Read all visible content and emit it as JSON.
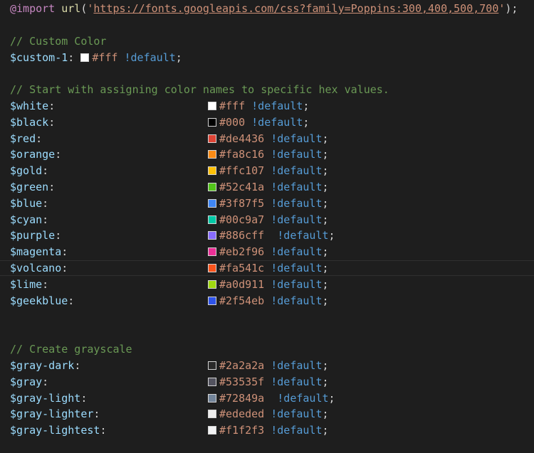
{
  "import_line": {
    "keyword": "@import",
    "func": "url",
    "open": "(",
    "quote_open": "'",
    "url": "https://fonts.googleapis.com/css?family=Poppins:300,400,500,700",
    "quote_close": "'",
    "close": ");"
  },
  "custom": {
    "comment": "// Custom Color",
    "name": "$custom-1",
    "colon": ":",
    "value": "#fff",
    "swatch": "#ffffff",
    "flag": "!default",
    "semi": ";"
  },
  "colors_comment": "// Start with assigning color names to specific hex values.",
  "colors": [
    {
      "name": "$white",
      "colon": ":",
      "value": "#fff",
      "swatch": "#ffffff",
      "gap": " ",
      "flag": "!default",
      "semi": ";"
    },
    {
      "name": "$black",
      "colon": ":",
      "value": "#000",
      "swatch": "#000000",
      "gap": " ",
      "flag": "!default",
      "semi": ";"
    },
    {
      "name": "$red",
      "colon": ":",
      "value": "#de4436",
      "swatch": "#de4436",
      "gap": " ",
      "flag": "!default",
      "semi": ";"
    },
    {
      "name": "$orange",
      "colon": ":",
      "value": "#fa8c16",
      "swatch": "#fa8c16",
      "gap": " ",
      "flag": "!default",
      "semi": ";"
    },
    {
      "name": "$gold",
      "colon": ":",
      "value": "#ffc107",
      "swatch": "#ffc107",
      "gap": " ",
      "flag": "!default",
      "semi": ";"
    },
    {
      "name": "$green",
      "colon": ":",
      "value": "#52c41a",
      "swatch": "#52c41a",
      "gap": " ",
      "flag": "!default",
      "semi": ";"
    },
    {
      "name": "$blue",
      "colon": ":",
      "value": "#3f87f5",
      "swatch": "#3f87f5",
      "gap": " ",
      "flag": "!default",
      "semi": ";"
    },
    {
      "name": "$cyan",
      "colon": ":",
      "value": "#00c9a7",
      "swatch": "#00c9a7",
      "gap": " ",
      "flag": "!default",
      "semi": ";"
    },
    {
      "name": "$purple",
      "colon": ":",
      "value": "#886cff",
      "swatch": "#886cff",
      "gap": "  ",
      "flag": "!default",
      "semi": ";"
    },
    {
      "name": "$magenta",
      "colon": ":",
      "value": "#eb2f96",
      "swatch": "#eb2f96",
      "gap": " ",
      "flag": "!default",
      "semi": ";"
    },
    {
      "name": "$volcano",
      "colon": ":",
      "value": "#fa541c",
      "swatch": "#fa541c",
      "gap": " ",
      "flag": "!default",
      "semi": ";"
    },
    {
      "name": "$lime",
      "colon": ":",
      "value": "#a0d911",
      "swatch": "#a0d911",
      "gap": " ",
      "flag": "!default",
      "semi": ";"
    },
    {
      "name": "$geekblue",
      "colon": ":",
      "value": "#2f54eb",
      "swatch": "#2f54eb",
      "gap": " ",
      "flag": "!default",
      "semi": ";"
    }
  ],
  "gray_comment": "// Create grayscale",
  "grays": [
    {
      "name": "$gray-dark",
      "colon": ":",
      "value": "#2a2a2a",
      "swatch": "#2a2a2a",
      "gap": " ",
      "flag": "!default",
      "semi": ";"
    },
    {
      "name": "$gray",
      "colon": ":",
      "value": "#53535f",
      "swatch": "#53535f",
      "gap": " ",
      "flag": "!default",
      "semi": ";"
    },
    {
      "name": "$gray-light",
      "colon": ":",
      "value": "#72849a",
      "swatch": "#72849a",
      "gap": "  ",
      "flag": "!default",
      "semi": ";"
    },
    {
      "name": "$gray-lighter",
      "colon": ":",
      "value": "#ededed",
      "swatch": "#ededed",
      "gap": " ",
      "flag": "!default",
      "semi": ";"
    },
    {
      "name": "$gray-lightest",
      "colon": ":",
      "value": "#f1f2f3",
      "swatch": "#f1f2f3",
      "gap": " ",
      "flag": "!default",
      "semi": ";"
    }
  ]
}
